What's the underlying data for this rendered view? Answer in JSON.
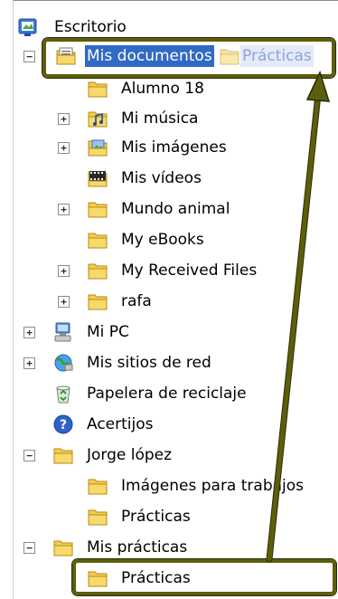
{
  "tree": {
    "desktop": {
      "label": "Escritorio",
      "icon": "desktop-icon"
    },
    "mis_documentos": {
      "label": "Mis documentos",
      "icon": "my-documents-icon",
      "expander": "−"
    },
    "alumno18": {
      "label": "Alumno 18",
      "icon": "folder-icon"
    },
    "mi_musica": {
      "label": "Mi música",
      "icon": "music-folder-icon",
      "expander": "+"
    },
    "mis_imagenes": {
      "label": "Mis imágenes",
      "icon": "pictures-folder-icon",
      "expander": "+"
    },
    "mis_videos": {
      "label": "Mis vídeos",
      "icon": "videos-folder-icon"
    },
    "mundo_animal": {
      "label": "Mundo animal",
      "icon": "folder-icon",
      "expander": "+"
    },
    "my_ebooks": {
      "label": "My eBooks",
      "icon": "folder-icon"
    },
    "my_received": {
      "label": "My Received Files",
      "icon": "folder-icon",
      "expander": "+"
    },
    "rafa": {
      "label": "rafa",
      "icon": "folder-icon",
      "expander": "+"
    },
    "mi_pc": {
      "label": "Mi PC",
      "icon": "computer-icon",
      "expander": "+"
    },
    "mis_sitios": {
      "label": "Mis sitios de red",
      "icon": "network-icon",
      "expander": "+"
    },
    "papelera": {
      "label": "Papelera de reciclaje",
      "icon": "recycle-bin-icon"
    },
    "acertijos": {
      "label": "Acertijos",
      "icon": "help-icon"
    },
    "jorge": {
      "label": "Jorge lópez",
      "icon": "folder-icon",
      "expander": "−"
    },
    "imagenes_trabajos": {
      "label": "Imágenes para trabajos",
      "icon": "folder-icon"
    },
    "practicas_jorge": {
      "label": "Prácticas",
      "icon": "folder-icon"
    },
    "mis_practicas": {
      "label": "Mis prácticas",
      "icon": "folder-icon",
      "expander": "−"
    },
    "practicas_sub": {
      "label": "Prácticas",
      "icon": "folder-icon"
    }
  },
  "drag_ghost": {
    "label": "Prácticas",
    "icon": "folder-icon"
  },
  "colors": {
    "selection": "#316ac5",
    "highlight": "#5c5e0c",
    "folder": "#f4cc52"
  }
}
